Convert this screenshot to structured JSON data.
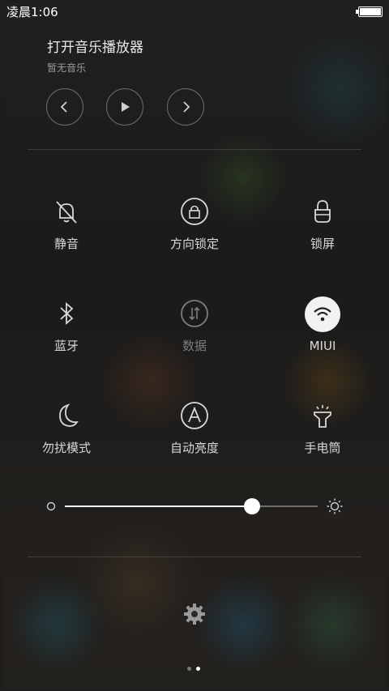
{
  "status_bar": {
    "time": "凌晨1:06",
    "battery_level": 1.0
  },
  "music": {
    "title": "打开音乐播放器",
    "subtitle": "暂无音乐",
    "controls": [
      "chevron-left-icon",
      "play-icon",
      "chevron-right-icon"
    ]
  },
  "toggles": [
    {
      "label": "静音",
      "icon": "bell-off-icon",
      "state": "off"
    },
    {
      "label": "方向锁定",
      "icon": "rotation-lock-icon",
      "state": "off"
    },
    {
      "label": "锁屏",
      "icon": "lock-icon",
      "state": "off"
    },
    {
      "label": "蓝牙",
      "icon": "bluetooth-icon",
      "state": "off"
    },
    {
      "label": "数据",
      "icon": "mobile-data-icon",
      "state": "disabled"
    },
    {
      "label": "MIUI",
      "icon": "wifi-icon",
      "state": "on"
    },
    {
      "label": "勿扰模式",
      "icon": "moon-icon",
      "state": "off"
    },
    {
      "label": "自动亮度",
      "icon": "auto-brightness-icon",
      "state": "off"
    },
    {
      "label": "手电筒",
      "icon": "flashlight-icon",
      "state": "off"
    }
  ],
  "brightness": {
    "level": 0.74
  },
  "settings": {
    "icon": "gear-icon"
  },
  "pager": {
    "pages": 2,
    "current": 2
  }
}
